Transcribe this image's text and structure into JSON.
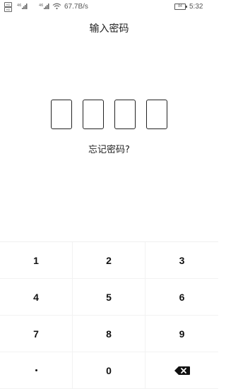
{
  "status_bar": {
    "sim1": "HD",
    "sim2": "HD",
    "signal1_label": "46",
    "signal2_label": "46",
    "speed": "67.7B/s",
    "battery": "84",
    "time": "5:32"
  },
  "page": {
    "title": "输入密码",
    "forgot_label": "忘记密码?"
  },
  "pin": {
    "length": 4,
    "entered": 0
  },
  "keypad": {
    "keys": [
      "1",
      "2",
      "3",
      "4",
      "5",
      "6",
      "7",
      "8",
      "9",
      "·",
      "0",
      "backspace"
    ],
    "icons": {
      "dot": "dot-icon",
      "backspace": "backspace-icon"
    }
  }
}
